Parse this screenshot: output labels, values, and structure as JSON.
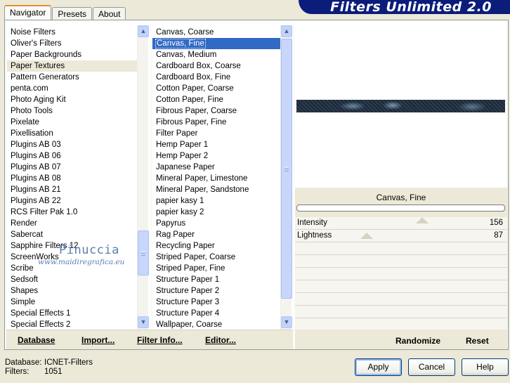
{
  "banner": {
    "title": "Filters Unlimited 2.0"
  },
  "tabs": [
    {
      "label": "Navigator",
      "active": true
    },
    {
      "label": "Presets",
      "active": false
    },
    {
      "label": "About",
      "active": false
    }
  ],
  "categories": {
    "items": [
      "Noise Filters",
      "Oliver's Filters",
      "Paper Backgrounds",
      "Paper Textures",
      "Pattern Generators",
      "penta.com",
      "Photo Aging Kit",
      "Photo Tools",
      "Pixelate",
      "Pixellisation",
      "Plugins AB 03",
      "Plugins AB 06",
      "Plugins AB 07",
      "Plugins AB 08",
      "Plugins AB 21",
      "Plugins AB 22",
      "RCS Filter Pak 1.0",
      "Render",
      "Sabercat",
      "Sapphire Filters 12",
      "ScreenWorks",
      "Scribe",
      "Sedsoft",
      "Shapes",
      "Simple",
      "Special Effects 1",
      "Special Effects 2"
    ],
    "selected": "Paper Textures"
  },
  "filters": {
    "items": [
      "Canvas, Coarse",
      "Canvas, Fine",
      "Canvas, Medium",
      "Cardboard Box, Coarse",
      "Cardboard Box, Fine",
      "Cotton Paper, Coarse",
      "Cotton Paper, Fine",
      "Fibrous Paper, Coarse",
      "Fibrous Paper, Fine",
      "Filter Paper",
      "Hemp Paper 1",
      "Hemp Paper 2",
      "Japanese Paper",
      "Mineral Paper, Limestone",
      "Mineral Paper, Sandstone",
      "papier kasy 1",
      "papier kasy 2",
      "Papyrus",
      "Rag Paper",
      "Recycling Paper",
      "Striped Paper, Coarse",
      "Striped Paper, Fine",
      "Structure Paper 1",
      "Structure Paper 2",
      "Structure Paper 3",
      "Structure Paper 4",
      "Wallpaper, Coarse"
    ],
    "selected": "Canvas, Fine"
  },
  "left_buttons": {
    "database": "Database",
    "import": "Import...",
    "filter_info": "Filter Info...",
    "editor": "Editor..."
  },
  "preview": {
    "filter_name": "Canvas, Fine"
  },
  "params": [
    {
      "label": "Intensity",
      "value": "156"
    },
    {
      "label": "Lightness",
      "value": "87"
    }
  ],
  "watermark": {
    "name": "Pinuccia",
    "url": "www.maidiregrafica.eu"
  },
  "right_buttons": {
    "randomize": "Randomize",
    "reset": "Reset"
  },
  "info": {
    "database_label": "Database:",
    "database_value": "ICNET-Filters",
    "filters_label": "Filters:",
    "filters_value": "1051"
  },
  "dialog_buttons": {
    "apply": "Apply",
    "cancel": "Cancel",
    "help": "Help"
  },
  "colors": {
    "banner": "#0b1c7a",
    "selection": "#316ac5",
    "tab_highlight": "#e68b2c"
  }
}
